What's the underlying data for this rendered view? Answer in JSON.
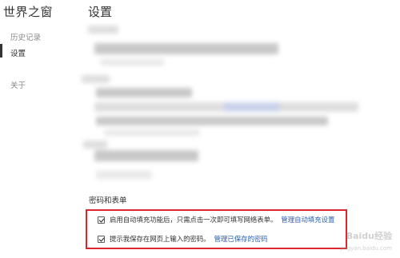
{
  "sidebar": {
    "brand": "世界之窗",
    "items": [
      {
        "label": "历史记录"
      },
      {
        "label": "设置"
      },
      {
        "label": "关于"
      }
    ]
  },
  "main": {
    "title": "设置",
    "section_title": "密码和表单",
    "options": [
      {
        "checked": true,
        "text": "启用自动填充功能后，只需点击一次即可填写网络表单。",
        "link": "管理自动填充设置"
      },
      {
        "checked": true,
        "text": "提示我保存在网页上输入的密码。",
        "link": "管理已保存的密码"
      }
    ]
  },
  "watermark": {
    "text": "Baidu经验",
    "sub": "jingyan.baidu.com"
  },
  "colors": {
    "highlight_border": "#e0242b",
    "link": "#2a5db0",
    "text": "#333333",
    "muted": "#8a8a8a"
  }
}
